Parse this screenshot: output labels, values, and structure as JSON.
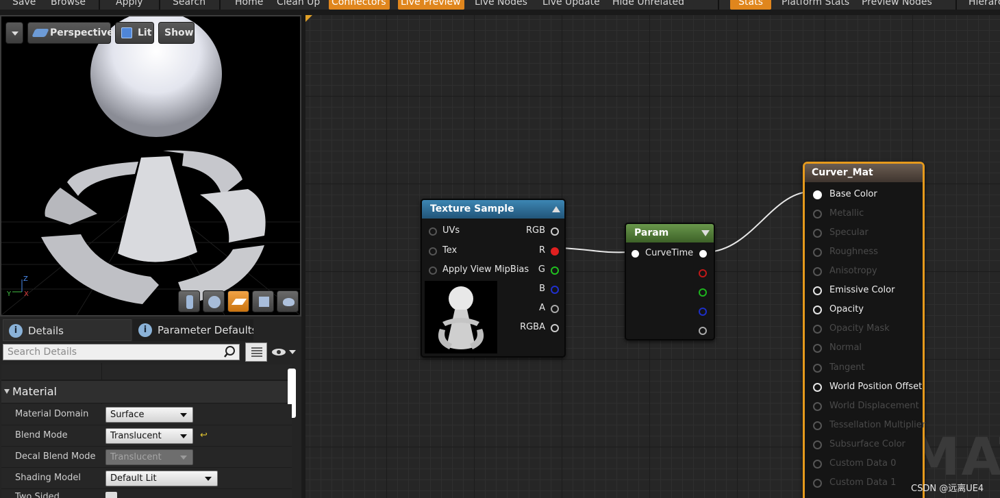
{
  "toolbar": {
    "buttons": [
      "Save",
      "Browse",
      "Apply",
      "Search",
      "Home",
      "Clean Up",
      "Connectors",
      "Live Preview",
      "Live Nodes",
      "Live Update",
      "Hide Unrelated",
      "Stats",
      "Platform Stats",
      "Preview Nodes",
      "Hierarc"
    ]
  },
  "viewport": {
    "mode": "Perspective",
    "lighting": "Lit",
    "show": "Show",
    "axis_y": "Y",
    "axis_z": "Z",
    "axis_x": "X"
  },
  "details": {
    "tab_details": "Details",
    "tab_params": "Parameter Defaults",
    "search_placeholder": "Search Details",
    "category": "Material",
    "props": [
      {
        "label": "Material Domain",
        "value": "Surface"
      },
      {
        "label": "Blend Mode",
        "value": "Translucent"
      },
      {
        "label": "Decal Blend Mode",
        "value": "Translucent"
      },
      {
        "label": "Shading Model",
        "value": "Default Lit"
      },
      {
        "label": "Two Sided"
      }
    ]
  },
  "texture_node": {
    "title": "Texture Sample",
    "inputs": [
      "UVs",
      "Tex",
      "Apply View MipBias"
    ],
    "outputs": [
      "RGB",
      "R",
      "G",
      "B",
      "A",
      "RGBA"
    ]
  },
  "param_node": {
    "title": "Param",
    "input": "CurveTime"
  },
  "result_node": {
    "title": "Curver_Mat",
    "pins": [
      "Base Color",
      "Metallic",
      "Specular",
      "Roughness",
      "Anisotropy",
      "Emissive Color",
      "Opacity",
      "Opacity Mask",
      "Normal",
      "Tangent",
      "World Position Offset",
      "World Displacement",
      "Tessellation Multiplier",
      "Subsurface Color",
      "Custom Data 0",
      "Custom Data 1"
    ]
  },
  "watermark": "MATER",
  "credit": "CSDN @远离UE4",
  "colors": {
    "accent": "#e0861d",
    "texture_header": "#2f6e96",
    "param_header": "#4f7a36",
    "result_header": "#5e5148",
    "result_border": "#e69a1c"
  }
}
